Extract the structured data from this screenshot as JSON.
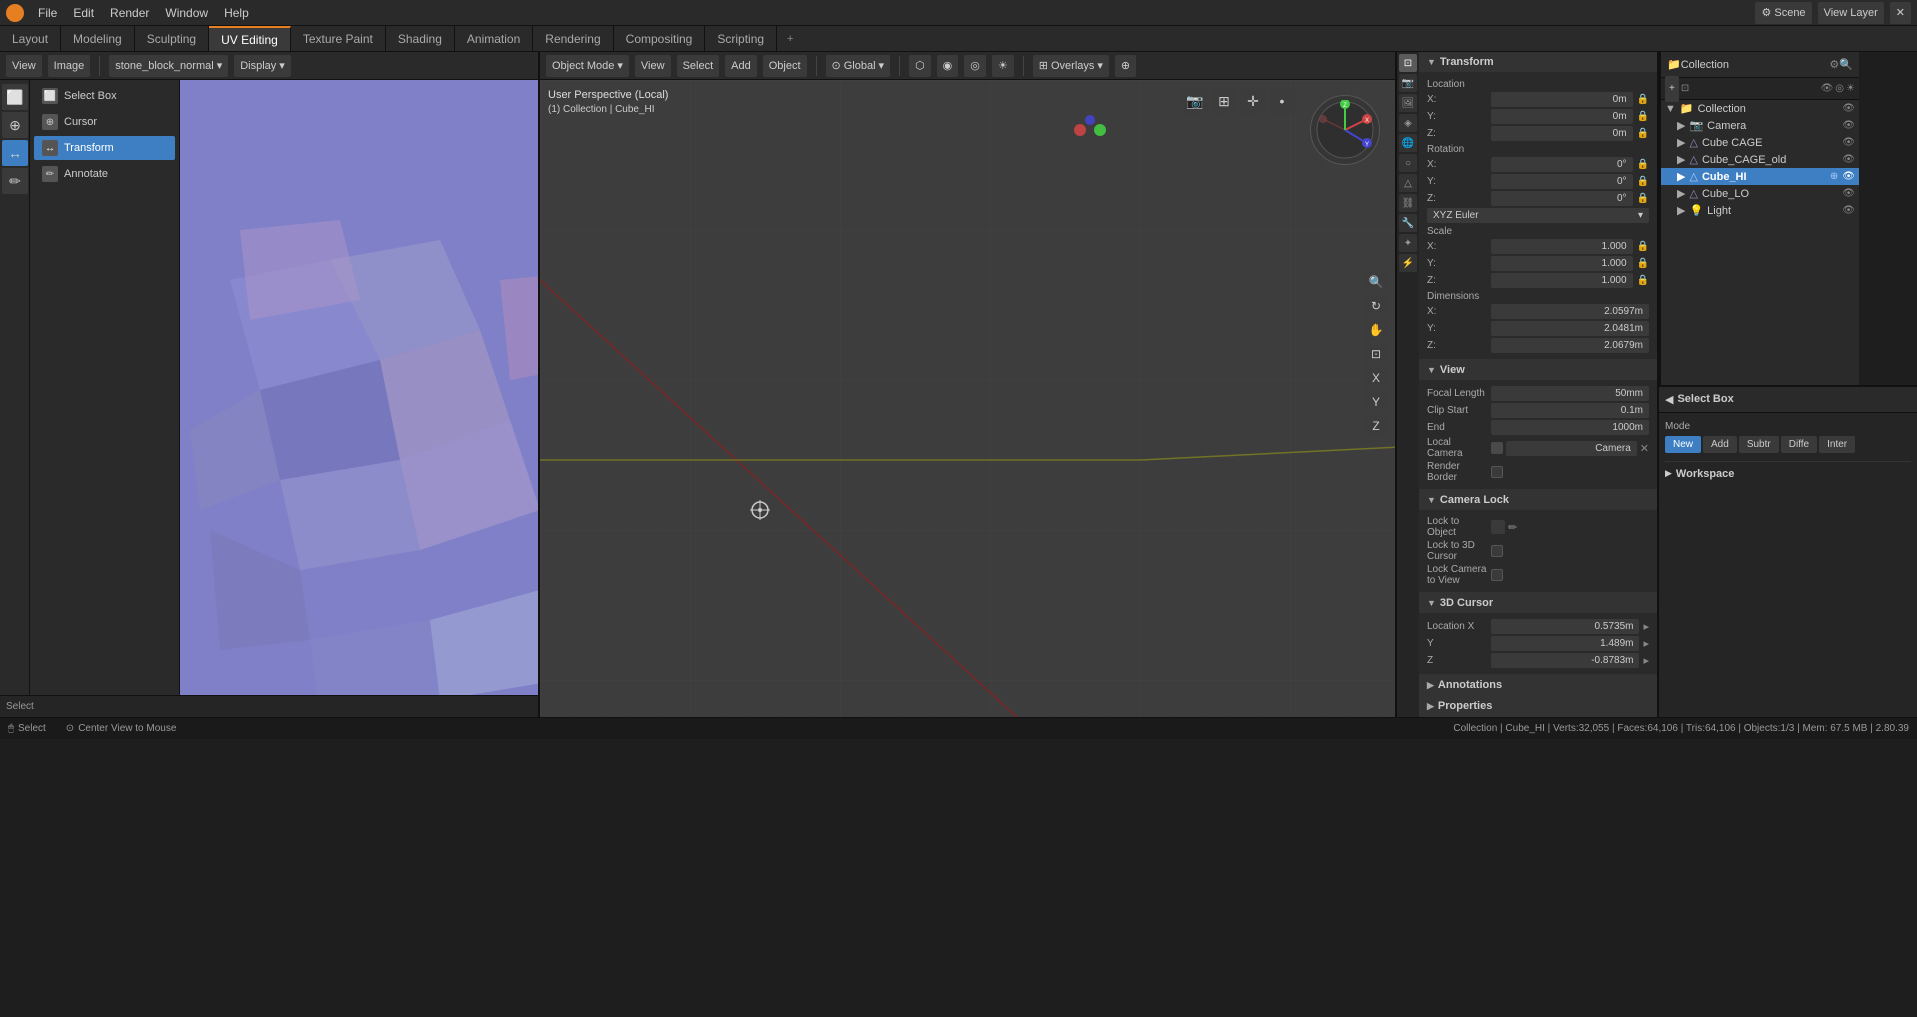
{
  "topMenu": {
    "items": [
      "File",
      "Edit",
      "Render",
      "Window",
      "Help"
    ],
    "rightItems": [
      "Scene",
      "View Layer"
    ]
  },
  "workspaceTabs": {
    "items": [
      "Layout",
      "Modeling",
      "Sculpting",
      "UV Editing",
      "Texture Paint",
      "Shading",
      "Animation",
      "Rendering",
      "Compositing",
      "Scripting"
    ],
    "active": "UV Editing",
    "plus": "+"
  },
  "uvEditorHeader": {
    "viewLabel": "View",
    "imageLabel": "Image",
    "imageName": "stone_block_normal",
    "displayLabel": "Display",
    "selectLabel": "Select"
  },
  "leftTools": {
    "items": [
      {
        "id": "select-box",
        "label": "Select Box",
        "icon": "⬜"
      },
      {
        "id": "cursor",
        "label": "Cursor",
        "icon": "⊕"
      },
      {
        "id": "transform",
        "label": "Transform",
        "icon": "↔"
      },
      {
        "id": "annotate",
        "label": "Annotate",
        "icon": "✏"
      }
    ],
    "active": "transform"
  },
  "viewport3d": {
    "perspective": "User Perspective (Local)",
    "collection": "(1) Collection | Cube_HI",
    "mode": "Object Mode",
    "shading": "Select",
    "pivot": "Global"
  },
  "properties": {
    "title": "Transform",
    "location": {
      "label": "Location",
      "x": {
        "label": "X:",
        "value": "0m"
      },
      "y": {
        "label": "Y:",
        "value": "0m"
      },
      "z": {
        "label": "Z:",
        "value": "0m"
      }
    },
    "rotation": {
      "label": "Rotation",
      "x": {
        "label": "X:",
        "value": "0°"
      },
      "y": {
        "label": "Y:",
        "value": "0°"
      },
      "z": {
        "label": "Z:",
        "value": "0°"
      },
      "mode": "XYZ Euler"
    },
    "scale": {
      "label": "Scale",
      "x": {
        "label": "X:",
        "value": "1.000"
      },
      "y": {
        "label": "Y:",
        "value": "1.000"
      },
      "z": {
        "label": "Z:",
        "value": "1.000"
      }
    },
    "dimensions": {
      "label": "Dimensions",
      "x": {
        "label": "X:",
        "value": "2.0597m"
      },
      "y": {
        "label": "Y:",
        "value": "2.0481m"
      },
      "z": {
        "label": "Z:",
        "value": "2.0679m"
      }
    },
    "view": {
      "label": "View",
      "focalLength": {
        "label": "Focal Length",
        "value": "50mm"
      },
      "clipStart": {
        "label": "Clip Start",
        "value": "0.1m"
      },
      "clipEnd": {
        "label": "End",
        "value": "1000m"
      },
      "localCamera": {
        "label": "Local Camera",
        "value": "Camera"
      },
      "renderBorder": {
        "label": "Render Border"
      }
    },
    "cameraLock": {
      "label": "Camera Lock",
      "lockToObject": {
        "label": "Lock to Object"
      },
      "lockTo3dCursor": {
        "label": "Lock to 3D Cursor"
      },
      "lockCameraToView": {
        "label": "Lock Camera to View"
      }
    },
    "cursor3d": {
      "label": "3D Cursor",
      "locationX": {
        "label": "Location X",
        "value": "0.5735m"
      },
      "y": {
        "label": "Y",
        "value": "1.489m"
      },
      "z": {
        "label": "Z",
        "value": "-0.8783m"
      }
    },
    "annotations": {
      "label": "Annotations"
    },
    "properties": {
      "label": "Properties"
    }
  },
  "outliner": {
    "title": "Collection",
    "items": [
      {
        "id": "collection",
        "label": "Collection",
        "icon": "📁",
        "indent": 0
      },
      {
        "id": "camera",
        "label": "Camera",
        "icon": "📷",
        "indent": 1
      },
      {
        "id": "cube-cage",
        "label": "Cube CAGE",
        "icon": "△",
        "indent": 1
      },
      {
        "id": "cube-cage-old",
        "label": "Cube_CAGE_old",
        "icon": "△",
        "indent": 1
      },
      {
        "id": "cube-hi",
        "label": "Cube_HI",
        "icon": "△",
        "indent": 1,
        "active": true
      },
      {
        "id": "cube-lo",
        "label": "Cube_LO",
        "icon": "△",
        "indent": 1
      },
      {
        "id": "light",
        "label": "Light",
        "icon": "💡",
        "indent": 1
      }
    ]
  },
  "brushPanel": {
    "title": "Select Box",
    "modeLabel": "Mode",
    "modes": [
      "New",
      "Add",
      "Subtr",
      "Diffe",
      "Inter"
    ],
    "activeMode": "New",
    "workspace": "Workspace"
  },
  "statusBar": {
    "left": "Select",
    "centerLeft": "Center View to Mouse",
    "info": "Collection | Cube_HI | Verts:32,055 | Faces:64,106 | Tris:64,106 | Objects:1/3 | Mem: 67.5 MB | 2.80.39"
  }
}
